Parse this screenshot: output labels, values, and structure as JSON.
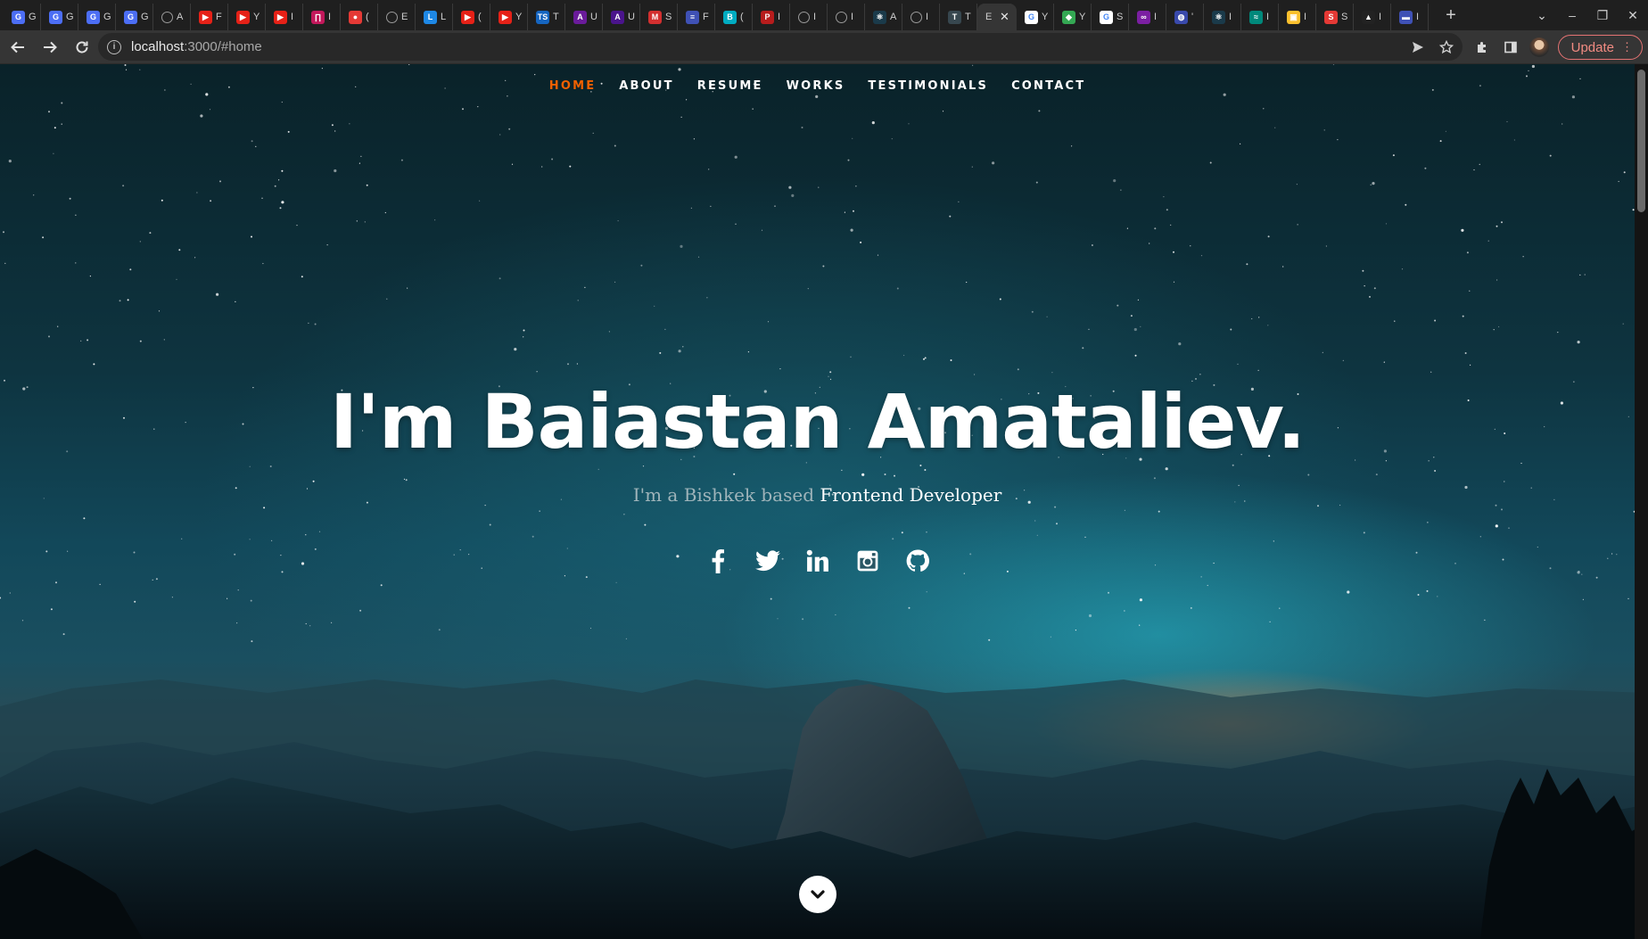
{
  "browser": {
    "tabs": [
      {
        "label": "G",
        "fav": "G",
        "color": "#4c6ef5"
      },
      {
        "label": "G",
        "fav": "G",
        "color": "#4c6ef5"
      },
      {
        "label": "G",
        "fav": "G",
        "color": "#4c6ef5"
      },
      {
        "label": "G",
        "fav": "G",
        "color": "#4c6ef5"
      },
      {
        "label": "A",
        "fav": "",
        "color": "#555555"
      },
      {
        "label": "F",
        "fav": "▶",
        "color": "#e62117"
      },
      {
        "label": "Y",
        "fav": "▶",
        "color": "#e62117"
      },
      {
        "label": "I",
        "fav": "▶",
        "color": "#e62117"
      },
      {
        "label": "I",
        "fav": "∏",
        "color": "#c2185b"
      },
      {
        "label": "(",
        "fav": "●",
        "color": "#e53935"
      },
      {
        "label": "E",
        "fav": "",
        "color": "#555555"
      },
      {
        "label": "L",
        "fav": "L",
        "color": "#1e88e5"
      },
      {
        "label": "(",
        "fav": "▶",
        "color": "#e62117"
      },
      {
        "label": "Y",
        "fav": "▶",
        "color": "#e62117"
      },
      {
        "label": "T",
        "fav": "TS",
        "color": "#1565c0"
      },
      {
        "label": "U",
        "fav": "A",
        "color": "#6a1b9a"
      },
      {
        "label": "U",
        "fav": "A",
        "color": "#4a148c"
      },
      {
        "label": "S",
        "fav": "M",
        "color": "#d32f2f"
      },
      {
        "label": "F",
        "fav": "≡",
        "color": "#3f51b5"
      },
      {
        "label": "(",
        "fav": "B",
        "color": "#00acc1"
      },
      {
        "label": "I",
        "fav": "P",
        "color": "#b71c1c"
      },
      {
        "label": "I",
        "fav": "",
        "color": "#555555"
      },
      {
        "label": "I",
        "fav": "",
        "color": "#555555"
      },
      {
        "label": "A",
        "fav": "⚛",
        "color": "#1a3a4a"
      },
      {
        "label": "I",
        "fav": "",
        "color": "#444444"
      },
      {
        "label": "T",
        "fav": "T",
        "color": "#37474f"
      }
    ],
    "active_tab": {
      "label": "E",
      "close": "✕"
    },
    "tabs_after": [
      {
        "label": "Y",
        "fav": "G",
        "color": "#ffffff"
      },
      {
        "label": "Y",
        "fav": "◆",
        "color": "#34a853"
      },
      {
        "label": "S",
        "fav": "G",
        "color": "#ffffff"
      },
      {
        "label": "I",
        "fav": "∞",
        "color": "#7b1fa2"
      },
      {
        "label": "'",
        "fav": "◍",
        "color": "#3949ab"
      },
      {
        "label": "I",
        "fav": "⚛",
        "color": "#1a3a4a"
      },
      {
        "label": "I",
        "fav": "≈",
        "color": "#00897b"
      },
      {
        "label": "I",
        "fav": "▣",
        "color": "#fbc02d"
      },
      {
        "label": "S",
        "fav": "S",
        "color": "#e53935"
      },
      {
        "label": "I",
        "fav": "▲",
        "color": "#222222"
      },
      {
        "label": "I",
        "fav": "▬",
        "color": "#3f51b5"
      }
    ],
    "new_tab": "+",
    "window": {
      "dropdown": "⌄",
      "minimize": "–",
      "restore": "❐",
      "close": "✕"
    },
    "url": {
      "host": "localhost",
      "path": ":3000/#home"
    },
    "update_label": "Update",
    "menu_dots": "⋮"
  },
  "site": {
    "nav": [
      {
        "label": "HOME",
        "current": true
      },
      {
        "label": "ABOUT",
        "current": false
      },
      {
        "label": "RESUME",
        "current": false
      },
      {
        "label": "WORKS",
        "current": false
      },
      {
        "label": "TESTIMONIALS",
        "current": false
      },
      {
        "label": "CONTACT",
        "current": false
      }
    ],
    "accent": "#f06000",
    "hero": {
      "title": "I'm Baiastan Amataliev.",
      "sub_prefix": "I'm a Bishkek based ",
      "sub_highlight": "Frontend Developer"
    },
    "socials": [
      "facebook-icon",
      "twitter-icon",
      "linkedin-icon",
      "instagram-icon",
      "github-icon"
    ]
  }
}
